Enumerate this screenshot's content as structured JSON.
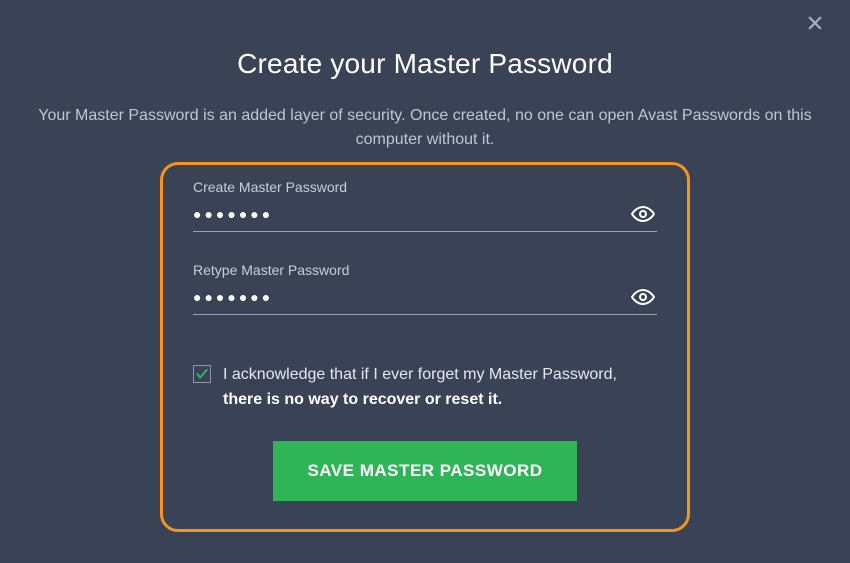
{
  "close_label": "Close",
  "title": "Create your Master Password",
  "subtitle": "Your Master Password is an added layer of security. Once created, no one can open Avast Passwords on this computer without it.",
  "fields": {
    "create": {
      "label": "Create Master Password",
      "value": "●●●●●●●"
    },
    "retype": {
      "label": "Retype Master Password",
      "value": "●●●●●●●"
    }
  },
  "acknowledge": {
    "checked": true,
    "text_prefix": "I acknowledge that if I ever forget my Master Password, ",
    "text_bold": "there is no way to recover or reset it."
  },
  "save_button": "SAVE MASTER PASSWORD",
  "colors": {
    "background": "#3a4256",
    "highlight_border": "#f7941d",
    "primary_button": "#2fb457",
    "checkbox_check": "#2fb457"
  }
}
